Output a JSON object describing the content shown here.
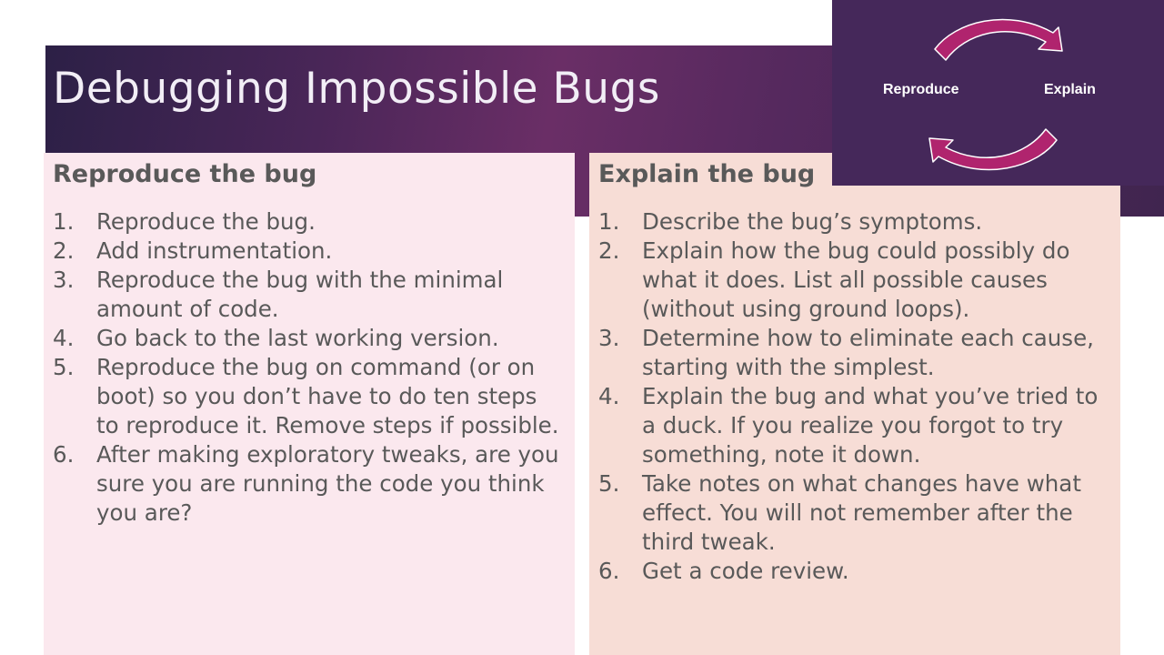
{
  "slide": {
    "title": "Debugging Impossible Bugs"
  },
  "cycle": {
    "left_label": "Reproduce",
    "right_label": "Explain"
  },
  "left_panel": {
    "heading": "Reproduce the bug",
    "steps": [
      {
        "num": "1.",
        "text": "Reproduce the bug."
      },
      {
        "num": "2.",
        "text": "Add instrumentation."
      },
      {
        "num": "3.",
        "text": "Reproduce the bug with the minimal amount of code."
      },
      {
        "num": "4.",
        "text": "Go back to the last working version."
      },
      {
        "num": "5.",
        "text": "Reproduce the bug on command (or on boot) so you don’t have to do ten steps to reproduce it. Remove steps if possible."
      },
      {
        "num": "6.",
        "text": "After making exploratory tweaks, are you sure you are running the code you think you are?"
      }
    ]
  },
  "right_panel": {
    "heading": "Explain the bug",
    "steps": [
      {
        "num": "1.",
        "text": "Describe the bug’s symptoms."
      },
      {
        "num": "2.",
        "text": "Explain how the bug could possibly do what it does. List all possible causes (without using ground loops)."
      },
      {
        "num": "3.",
        "text": "Determine how to eliminate each cause, starting with the simplest."
      },
      {
        "num": "4.",
        "text": "Explain the bug and what you’ve tried to a duck. If you realize you forgot to try something, note it down."
      },
      {
        "num": "5.",
        "text": "Take notes on what changes have what effect. You will not remember after the third tweak."
      },
      {
        "num": "6.",
        "text": "Get a code review."
      }
    ]
  },
  "colors": {
    "title_band": "#4a2658",
    "cycle_box": "#45285a",
    "arrow": "#b0246e",
    "left_panel": "#fbe8ee",
    "right_panel": "#f7ddd6",
    "body_text": "#595959"
  },
  "icons": {
    "top_arrow": "curved-arrow-right-icon",
    "bottom_arrow": "curved-arrow-left-icon"
  }
}
